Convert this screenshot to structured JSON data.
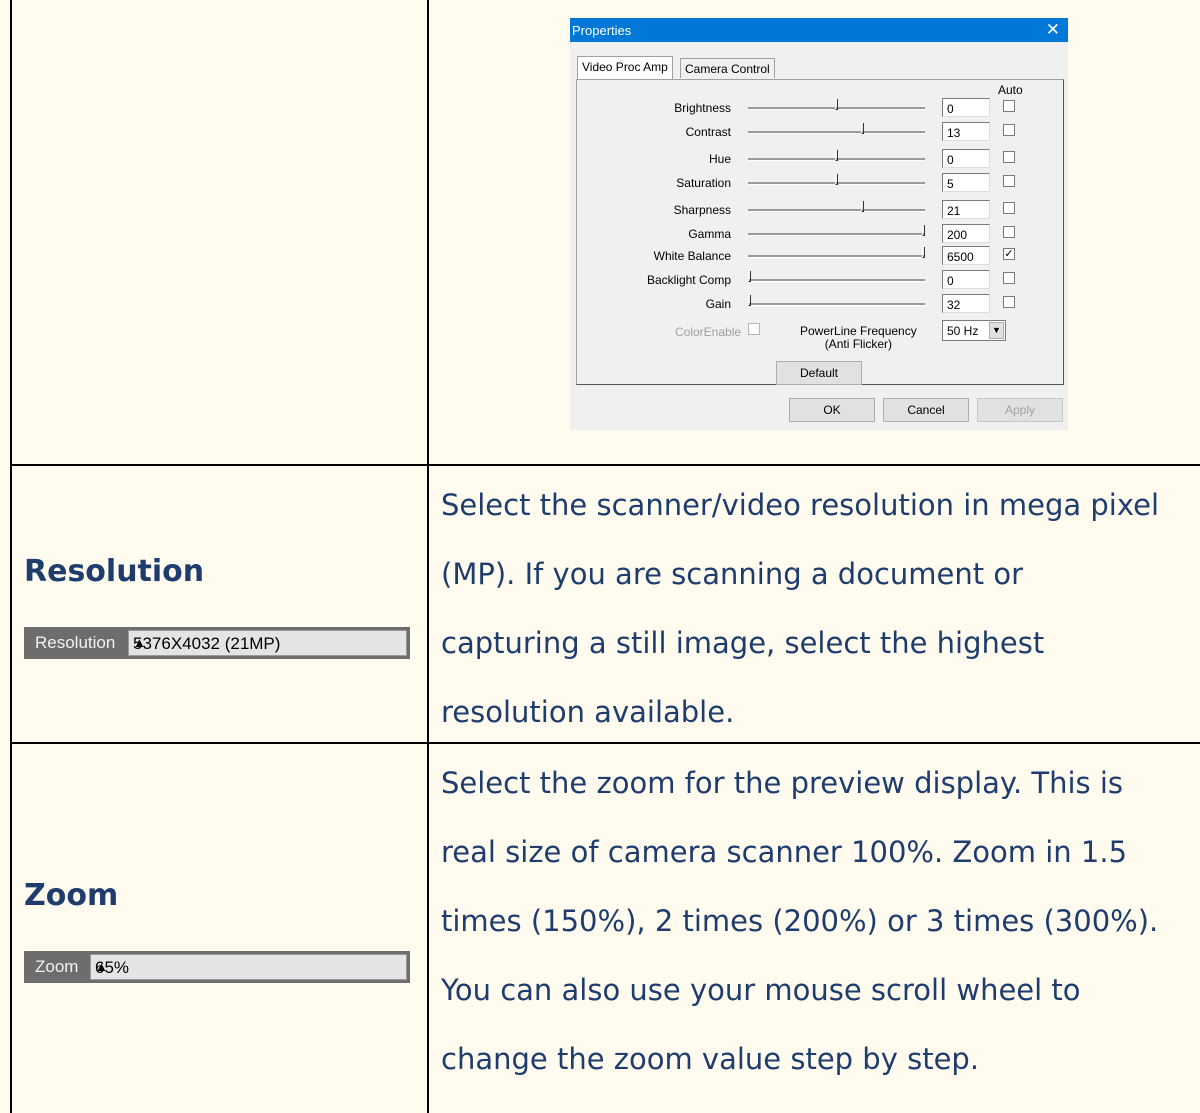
{
  "dialog": {
    "title": "Properties",
    "tabs": [
      "Video Proc Amp",
      "Camera Control"
    ],
    "auto_header": "Auto",
    "properties": [
      {
        "label": "Brightness",
        "value": "0",
        "level": 0.5,
        "auto": false
      },
      {
        "label": "Contrast",
        "value": "13",
        "level": 0.65,
        "auto": false
      },
      {
        "label": "Hue",
        "value": "0",
        "level": 0.5,
        "auto": false
      },
      {
        "label": "Saturation",
        "value": "5",
        "level": 0.5,
        "auto": false
      },
      {
        "label": "Sharpness",
        "value": "21",
        "level": 0.65,
        "auto": false
      },
      {
        "label": "Gamma",
        "value": "200",
        "level": 1.0,
        "auto": false
      },
      {
        "label": "White Balance",
        "value": "6500",
        "level": 1.0,
        "auto": true
      },
      {
        "label": "Backlight Comp",
        "value": "0",
        "level": 0.0,
        "auto": false
      },
      {
        "label": "Gain",
        "value": "32",
        "level": 0.0,
        "auto": false
      }
    ],
    "color_enable": "ColorEnable",
    "powerline_label_1": "PowerLine Frequency",
    "powerline_label_2": "(Anti Flicker)",
    "powerline_value": "50 Hz",
    "default_button": "Default",
    "ok_button": "OK",
    "cancel_button": "Cancel",
    "apply_button": "Apply"
  },
  "rows": [
    {
      "heading": "Resolution",
      "control_label": "Resolution",
      "control_value": "5376X4032 (21MP)",
      "description": [
        "Select the scanner/video resolution in mega pixel",
        "(MP). If you are scanning a document or",
        "capturing a still image, select the highest",
        "resolution available."
      ]
    },
    {
      "heading": "Zoom",
      "control_label": "Zoom",
      "control_value": "65%",
      "description": [
        "Select the zoom for the preview display. This is",
        "real size of camera scanner 100%. Zoom in 1.5",
        "times (150%), 2 times (200%) or 3 times (300%).",
        "You can also use your mouse scroll wheel to",
        "change the zoom value step by step."
      ]
    }
  ],
  "colors": {
    "page_background": "#fffbef",
    "text": "#1f3c6e",
    "dialog_titlebar": "#0078d7"
  }
}
